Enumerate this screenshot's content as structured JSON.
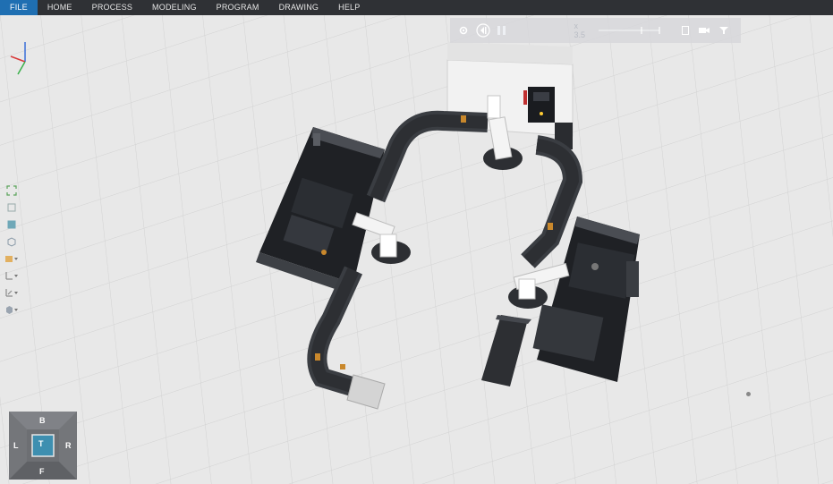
{
  "menu": {
    "items": [
      {
        "label": "FILE",
        "active": true
      },
      {
        "label": "HOME",
        "active": false
      },
      {
        "label": "PROCESS",
        "active": false
      },
      {
        "label": "MODELING",
        "active": false
      },
      {
        "label": "PROGRAM",
        "active": false
      },
      {
        "label": "DRAWING",
        "active": false
      },
      {
        "label": "HELP",
        "active": false
      }
    ]
  },
  "playback": {
    "speed_label": "x 3.5",
    "icons": [
      "gear-icon",
      "rewind-icon",
      "play-icon",
      "timeline-slider",
      "document-icon",
      "camera-icon",
      "filter-icon"
    ]
  },
  "navcube": {
    "top": "T",
    "north": "B",
    "south": "F",
    "west": "L",
    "east": "R"
  },
  "colors": {
    "menubar": "#2f3135",
    "active_tab": "#1f6fb2",
    "viewport_bg": "#e8e8e8",
    "machine_dark": "#2a2c30",
    "conveyor": "#34373c"
  }
}
